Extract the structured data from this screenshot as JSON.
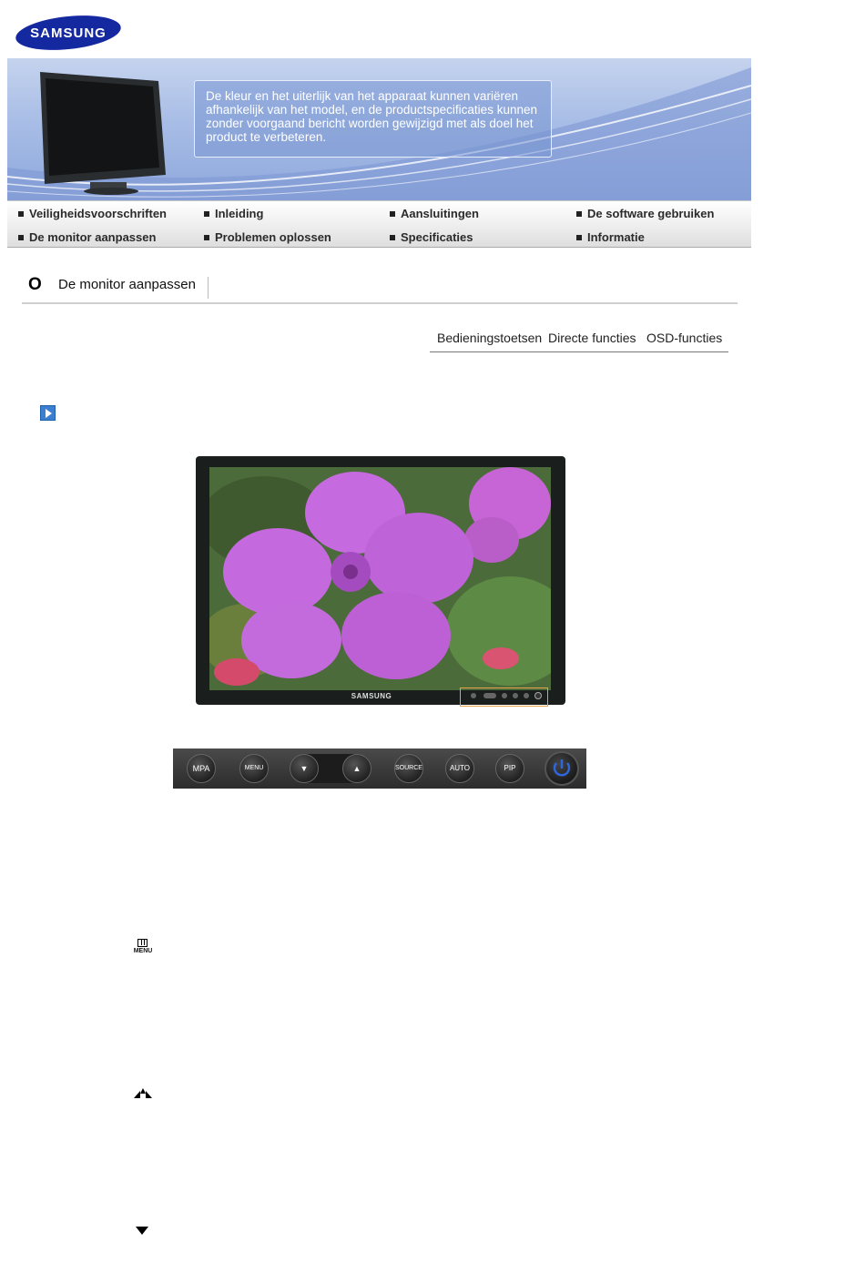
{
  "brand": {
    "logo_text": "SAMSUNG"
  },
  "banner": {
    "notice": "De kleur en het uiterlijk van het apparaat kunnen variëren afhankelijk van het model, en de productspecificaties kunnen zonder voorgaand bericht worden gewijzigd met als doel het product te verbeteren."
  },
  "nav": {
    "items": [
      "Veiligheidsvoorschriften",
      "Inleiding",
      "Aansluitingen",
      "De software gebruiken",
      "De monitor aanpassen",
      "Problemen oplossen",
      "Specificaties",
      "Informatie"
    ]
  },
  "section": {
    "bullet": "O",
    "title": "De monitor aanpassen"
  },
  "tabs": [
    "Bedieningstoetsen",
    "Directe functies",
    "OSD-functies"
  ],
  "monitor": {
    "brand_label": "SAMSUNG"
  },
  "control_strip": {
    "buttons": [
      "MPA",
      "MENU",
      "SOURCE",
      "AUTO",
      "PIP"
    ],
    "power_color": "#2f66d8"
  },
  "icons": {
    "menu_icon_label": "MENU"
  },
  "colors": {
    "banner_blue": "#8ea8dc",
    "nav_bg": "#e6e6e6",
    "highlight_box": "#e9a24a"
  }
}
